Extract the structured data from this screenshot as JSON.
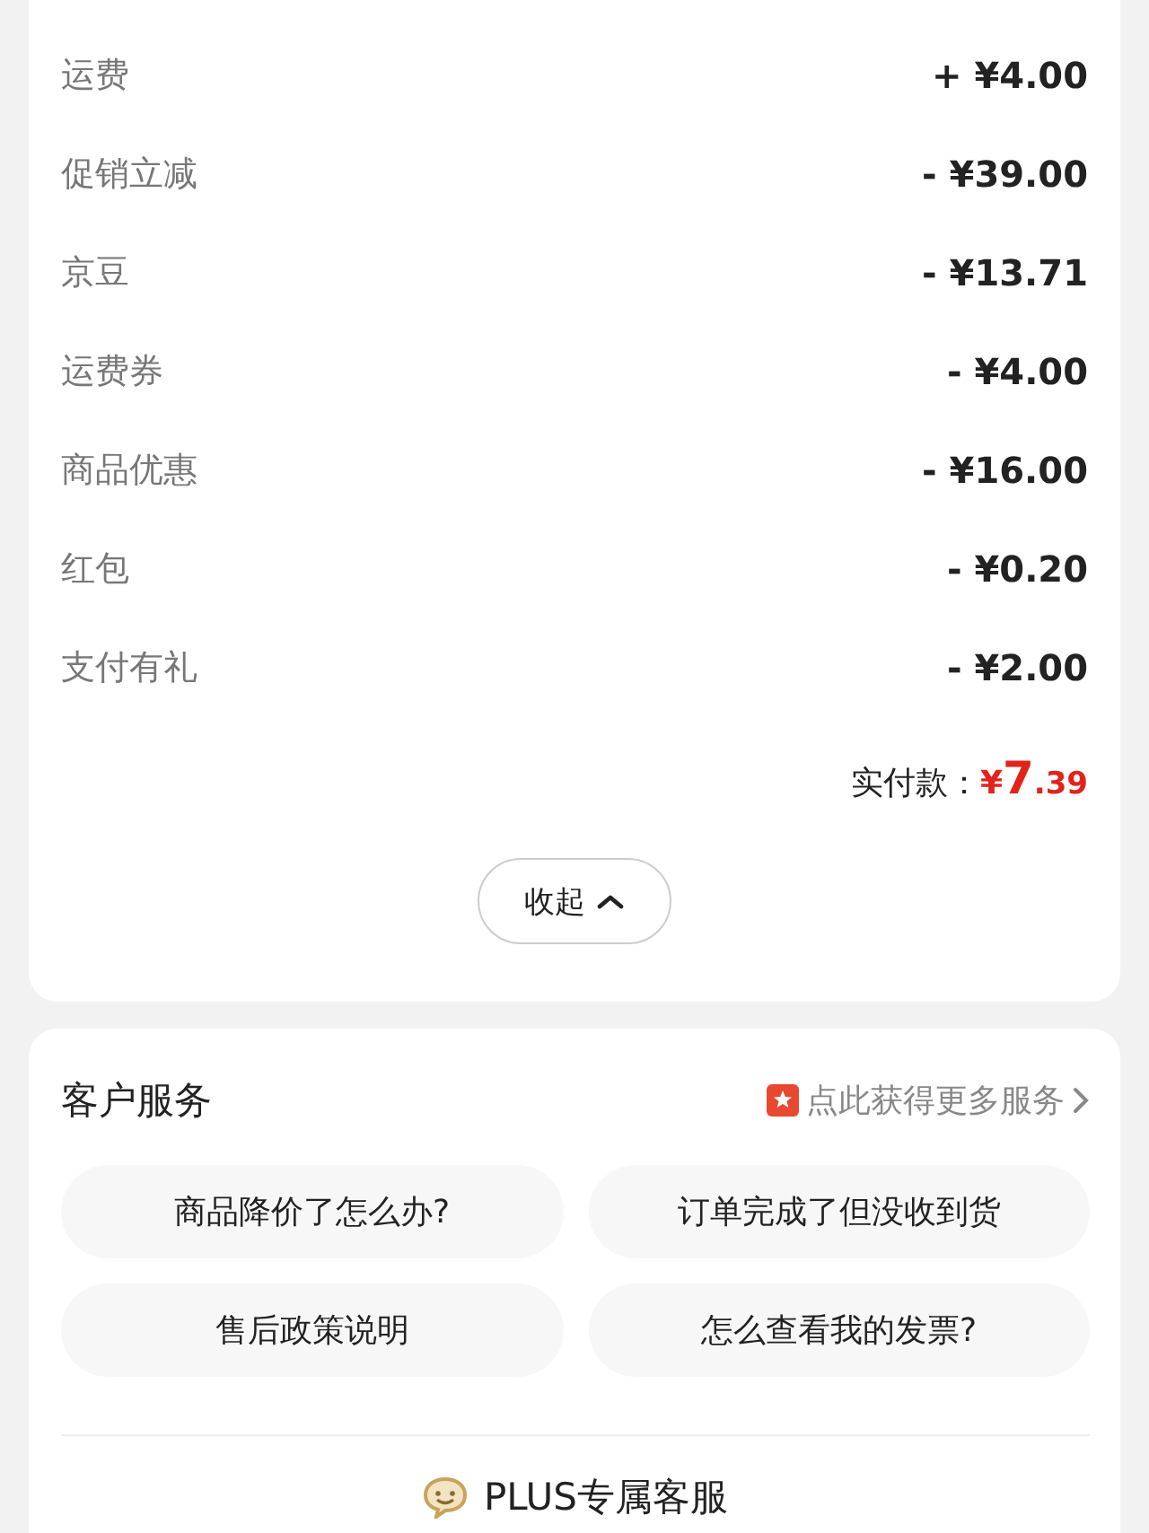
{
  "fees": [
    {
      "label": "运费",
      "amount": "+ ¥4.00"
    },
    {
      "label": "促销立减",
      "amount": "- ¥39.00"
    },
    {
      "label": "京豆",
      "amount": "- ¥13.71"
    },
    {
      "label": "运费券",
      "amount": "- ¥4.00"
    },
    {
      "label": "商品优惠",
      "amount": "- ¥16.00"
    },
    {
      "label": "红包",
      "amount": "- ¥0.20"
    },
    {
      "label": "支付有礼",
      "amount": "- ¥2.00"
    }
  ],
  "total": {
    "label": "实付款：",
    "currency": "¥",
    "integer": "7",
    "decimal": ".39"
  },
  "collapse_button": {
    "label": "收起"
  },
  "customer_service": {
    "title": "客户服务",
    "more_link": "点此获得更多服务",
    "questions": [
      "商品降价了怎么办?",
      "订单完成了但没收到货",
      "售后政策说明",
      "怎么查看我的发票?"
    ],
    "plus_service": "PLUS专属客服"
  }
}
